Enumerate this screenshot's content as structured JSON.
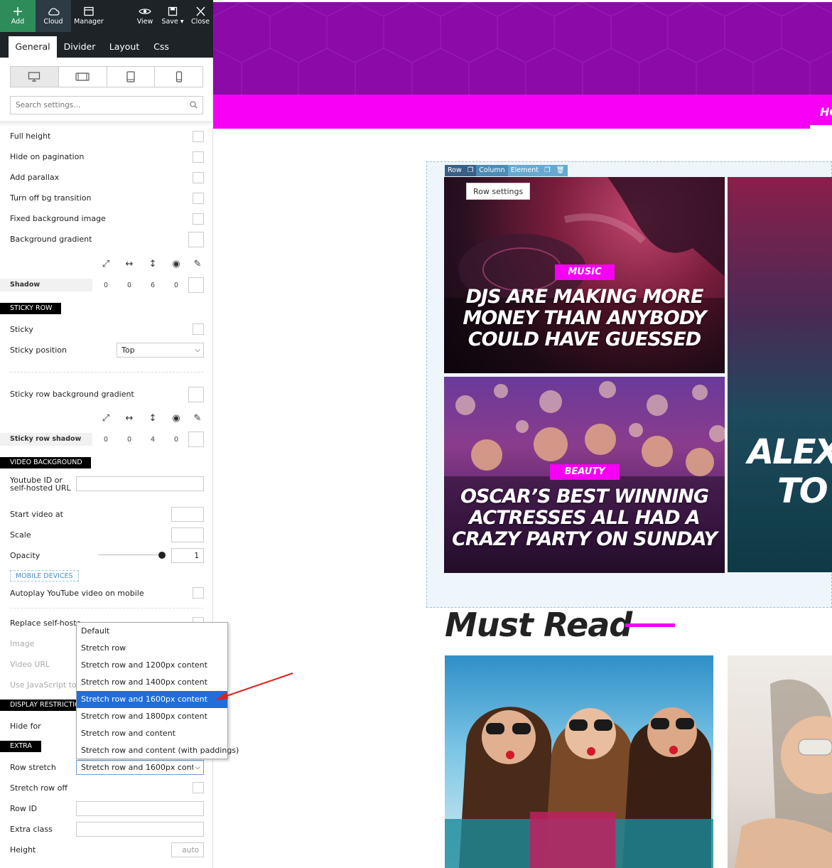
{
  "toolbar": {
    "add": "Add",
    "cloud": "Cloud",
    "manager": "Manager",
    "view": "View",
    "save": "Save ▾",
    "close": "Close"
  },
  "tabs": [
    "General",
    "Divider",
    "Layout",
    "Css"
  ],
  "search": {
    "placeholder": "Search settings..."
  },
  "settings": {
    "full_height": "Full height",
    "hide_on_pagination": "Hide on pagination",
    "add_parallax": "Add parallax",
    "turn_off_bg_transition": "Turn off bg transition",
    "fixed_background_image": "Fixed background image",
    "background_gradient": "Background gradient",
    "shadow": {
      "label": "Shadow",
      "values": [
        "0",
        "0",
        "6",
        "0"
      ]
    },
    "sticky_section": "STICKY ROW",
    "sticky": "Sticky",
    "sticky_position": "Sticky position",
    "sticky_position_value": "Top",
    "sticky_row_background_gradient": "Sticky row background gradient",
    "sticky_shadow": {
      "label": "Sticky row shadow",
      "values": [
        "0",
        "0",
        "4",
        "0"
      ]
    },
    "video_section": "VIDEO BACKGROUND",
    "youtube_label_1": "Youtube ID or",
    "youtube_label_2": "self-hosted URL",
    "start_video_at": "Start video at",
    "scale": "Scale",
    "opacity": "Opacity",
    "opacity_value": "1",
    "mobile_devices": "MOBILE DEVICES",
    "autoplay_mobile": "Autoplay YouTube video on mobile",
    "replace_self_hosted": "Replace self-hoste",
    "image": "Image",
    "video_url": "Video URL",
    "use_javascript": "Use JavaScript to b",
    "display_section": "DISPLAY RESTRICTIO",
    "hide_for": "Hide for",
    "extra_section": "EXTRA",
    "row_stretch": "Row stretch",
    "row_stretch_value": "Stretch row and 1600px conte",
    "stretch_row_off": "Stretch row off",
    "row_id": "Row ID",
    "extra_class": "Extra class",
    "height": "Height",
    "height_value": "auto"
  },
  "dropdown": {
    "options": [
      "Default",
      "Stretch row",
      "Stretch row and 1200px content",
      "Stretch row and 1400px content",
      "Stretch row and 1600px content",
      "Stretch row and 1800px content",
      "Stretch row and content",
      "Stretch row and content (with paddings)"
    ],
    "highlighted_index": 4
  },
  "canvas": {
    "nav_item": "HO",
    "row_bar": {
      "row": "Row",
      "column": "Column",
      "element": "Element"
    },
    "tooltip": "Row settings",
    "cards": [
      {
        "category": "MUSIC",
        "title": [
          "DJS ARE MAKING MORE",
          "MONEY THAN ANYBODY",
          "COULD HAVE GUESSED"
        ]
      },
      {
        "category": "BEAUTY",
        "title": [
          "OSCAR’S BEST WINNING",
          "ACTRESSES ALL HAD A",
          "CRAZY PARTY ON SUNDAY"
        ]
      }
    ],
    "side_title": [
      "ALEX",
      "TO"
    ],
    "must_read": "Must Read"
  },
  "colors": {
    "accent": "#f500f5",
    "hero": "#8b0aa8",
    "highlight": "#1e6fd9",
    "toolbar": "#1d2327"
  }
}
